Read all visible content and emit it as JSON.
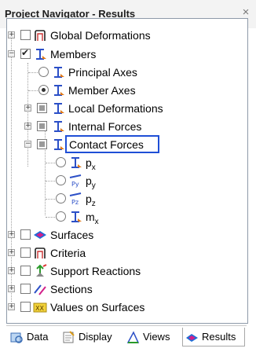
{
  "panel": {
    "title": "Project Navigator - Results",
    "close_glyph": "×"
  },
  "tree": {
    "global_deformations": "Global Deformations",
    "members": "Members",
    "principal_axes": "Principal Axes",
    "member_axes": "Member Axes",
    "local_deformations": "Local Deformations",
    "internal_forces": "Internal Forces",
    "contact_forces": "Contact Forces",
    "px": "p",
    "px_sub": "x",
    "py": "p",
    "py_sub": "y",
    "pz": "p",
    "pz_sub": "z",
    "mx": "m",
    "mx_sub": "x",
    "surfaces": "Surfaces",
    "criteria": "Criteria",
    "support_reactions": "Support Reactions",
    "sections": "Sections",
    "values_on_surfaces": "Values on Surfaces",
    "py_icon_text": "Py",
    "pz_icon_text": "Pz",
    "values_icon_text": "XX"
  },
  "tabs": [
    {
      "label": "Data",
      "icon": "data-icon"
    },
    {
      "label": "Display",
      "icon": "display-icon"
    },
    {
      "label": "Views",
      "icon": "views-icon"
    },
    {
      "label": "Results",
      "icon": "results-icon",
      "active": true
    }
  ],
  "colors": {
    "selection_border": "#1f4fd6",
    "member_icon_blue": "#2b4fc7",
    "member_icon_orange": "#e07a1a",
    "surface_blue": "#1a6fd8",
    "surface_magenta": "#d21f8a"
  }
}
